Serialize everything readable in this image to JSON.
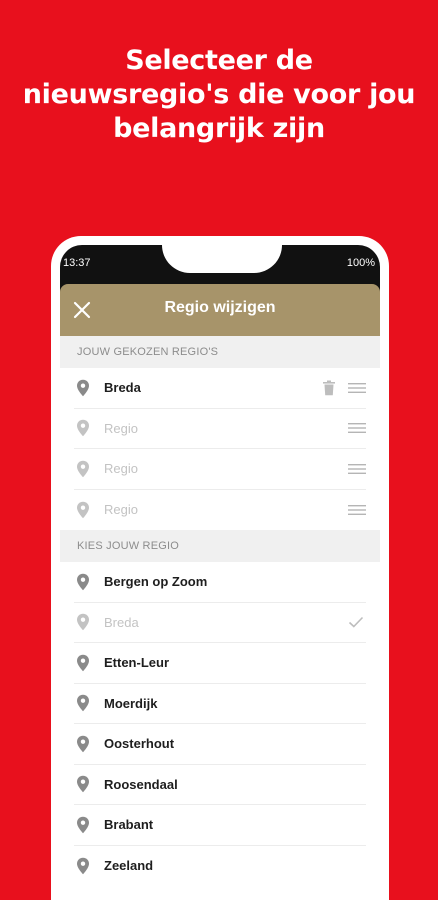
{
  "headline": {
    "line1": "Selecteer de",
    "line2": "nieuwsregio's die voor jou",
    "line3": "belangrijk zijn"
  },
  "status_bar": {
    "time": "13:37",
    "battery": "100%"
  },
  "header": {
    "title": "Regio wijzigen"
  },
  "selected_section": {
    "title": "JOUW GEKOZEN REGIO'S",
    "items": [
      {
        "label": "Breda",
        "state": "selected"
      },
      {
        "label": "Regio",
        "state": "empty"
      },
      {
        "label": "Regio",
        "state": "empty"
      },
      {
        "label": "Regio",
        "state": "empty"
      }
    ]
  },
  "choose_section": {
    "title": "KIES JOUW REGIO",
    "items": [
      {
        "label": "Bergen op Zoom",
        "checked": false
      },
      {
        "label": "Breda",
        "checked": true
      },
      {
        "label": "Etten-Leur",
        "checked": false
      },
      {
        "label": "Moerdijk",
        "checked": false
      },
      {
        "label": "Oosterhout",
        "checked": false
      },
      {
        "label": "Roosendaal",
        "checked": false
      },
      {
        "label": "Brabant",
        "checked": false
      },
      {
        "label": "Zeeland",
        "checked": false
      }
    ]
  },
  "icons": {
    "close": "close-icon",
    "pin": "location-pin-icon",
    "trash": "trash-icon",
    "drag": "drag-handle-icon",
    "check": "checkmark-icon"
  },
  "colors": {
    "background": "#e8101d",
    "header": "#a7946a",
    "section_bg": "#f0f0f0",
    "pin": "#8a8a8a",
    "muted": "#c3c3c3"
  }
}
